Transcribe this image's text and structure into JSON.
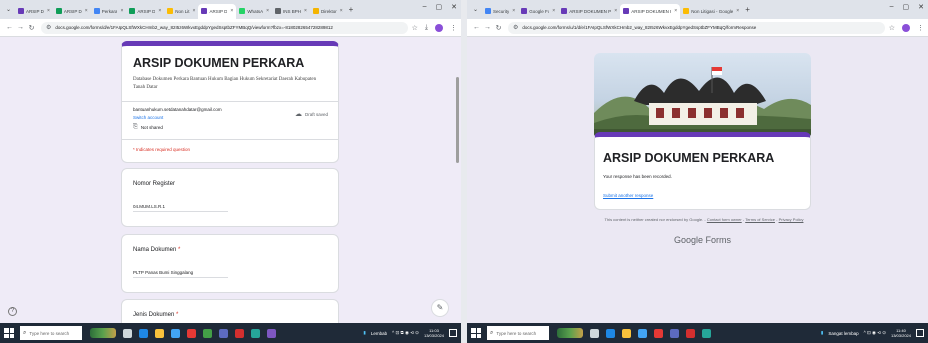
{
  "left": {
    "tabs": [
      {
        "label": "ARSIP D",
        "color": "#673ab7",
        "active": false
      },
      {
        "label": "ARSIP D",
        "color": "#0f9d58",
        "active": false
      },
      {
        "label": "Perkara",
        "color": "#4285f4",
        "active": false
      },
      {
        "label": "ARSIP D",
        "color": "#0f9d58",
        "active": false
      },
      {
        "label": "Non Lit",
        "color": "#fbbc04",
        "active": false
      },
      {
        "label": "ARSIP D",
        "color": "#673ab7",
        "active": true
      },
      {
        "label": "WhatsA",
        "color": "#25d366",
        "active": false
      },
      {
        "label": "INS BPH",
        "color": "#5f6368",
        "active": false
      },
      {
        "label": "Direktor",
        "color": "#f4b400",
        "active": false
      }
    ],
    "url": "docs.google.com/forms/d/e/1FAIpQLSfWXkCHmb2_way_82I5z6WkvxEgddpYgedSsptbZFYMBqQ/viewform?fbzx=-8180282654728289812",
    "form": {
      "title": "ARSIP DOKUMEN PERKARA",
      "description": "Database Dokumen Perkara Bantuan Hukum Bagian Hukum Sekretariat Daerah Kabupaten Tanah Datar",
      "email": "bantuanhukum.setdatanahdatar@gmail.com",
      "switch_account": "Switch account",
      "not_shared": "Not shared",
      "draft_saved": "Draft saved",
      "required_note": "* Indicates required question"
    },
    "questions": [
      {
        "label": "Nomor Register",
        "required": false,
        "answer": "04.MUM.LS.R.1"
      },
      {
        "label": "Nama Dokumen",
        "required": true,
        "answer": "PLTP Panas Bumi Singgalang"
      },
      {
        "label": "Jenis Dokumen",
        "required": true,
        "answer": ""
      }
    ],
    "taskbar": {
      "search_placeholder": "Type here to search",
      "weather": "Lembab",
      "time": "11:03",
      "date": "13/03/2024"
    }
  },
  "right": {
    "tabs": [
      {
        "label": "Security",
        "color": "#4285f4",
        "active": false
      },
      {
        "label": "Google Forms",
        "color": "#673ab7",
        "active": false
      },
      {
        "label": "ARSIP DOKUMEN PERKARA",
        "color": "#673ab7",
        "active": false
      },
      {
        "label": "ARSIP DOKUMEN PERKARA",
        "color": "#673ab7",
        "active": true
      },
      {
        "label": "Non Litigasi - Google Drive",
        "color": "#fbbc04",
        "active": false
      }
    ],
    "url": "docs.google.com/forms/u/1/d/e/1FAIpQLSfWXkCHmb2_way_82I5z6WkvxEgddpYgedSsptbZFYMBqQ/formResponse",
    "form": {
      "title": "ARSIP DOKUMEN PERKARA",
      "recorded": "Your response has been recorded.",
      "submit_another": "Submit another response",
      "footer_prefix": "This content is neither created nor endorsed by Google. -",
      "report_abuse": "Contact form owner",
      "terms": "Terms of Service",
      "privacy": "Privacy Policy",
      "brand": "Google Forms"
    },
    "taskbar": {
      "search_placeholder": "Type here to search",
      "weather": "Sangat lembap",
      "time": "11:40",
      "date": "13/03/2024"
    }
  },
  "colors": {
    "accent": "#673ab7",
    "link": "#1a73e8",
    "required": "#d93025",
    "taskbar": "#1f2a38"
  }
}
